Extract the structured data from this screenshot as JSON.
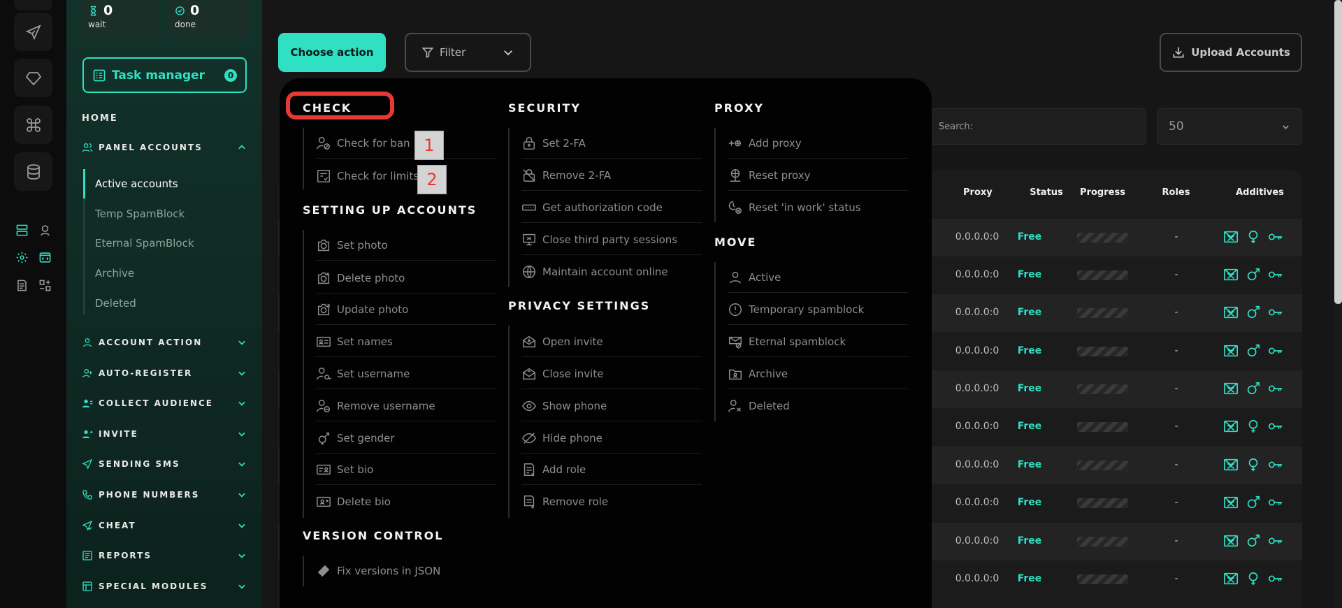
{
  "stats": {
    "wait_value": "0",
    "wait_label": "wait",
    "done_value": "0",
    "done_label": "done"
  },
  "task_manager": {
    "label": "Task manager",
    "badge": "0"
  },
  "nav": {
    "home": "HOME",
    "panel_accounts": "PANEL ACCOUNTS",
    "sub_items": [
      "Active accounts",
      "Temp SpamBlock",
      "Eternal SpamBlock",
      "Archive",
      "Deleted"
    ],
    "sections": [
      "ACCOUNT ACTION",
      "AUTO-REGISTER",
      "COLLECT AUDIENCE",
      "INVITE",
      "SENDING SMS",
      "PHONE NUMBERS",
      "CHEAT",
      "REPORTS",
      "SPECIAL MODULES"
    ]
  },
  "toolbar": {
    "choose_action": "Choose action",
    "filter": "Filter",
    "upload": "Upload Accounts"
  },
  "search": {
    "placeholder": "Search:"
  },
  "per_page": {
    "value": "50"
  },
  "table": {
    "headers": {
      "proxy": "Proxy",
      "status": "Status",
      "progress": "Progress",
      "roles": "Roles",
      "additives": "Additives"
    },
    "rows": [
      {
        "proxy": "0.0.0.0:0",
        "status": "Free",
        "roles": "-",
        "gender": "female"
      },
      {
        "proxy": "0.0.0.0:0",
        "status": "Free",
        "roles": "-",
        "gender": "male"
      },
      {
        "proxy": "0.0.0.0:0",
        "status": "Free",
        "roles": "-",
        "gender": "male"
      },
      {
        "proxy": "0.0.0.0:0",
        "status": "Free",
        "roles": "-",
        "gender": "male"
      },
      {
        "proxy": "0.0.0.0:0",
        "status": "Free",
        "roles": "-",
        "gender": "male"
      },
      {
        "proxy": "0.0.0.0:0",
        "status": "Free",
        "roles": "-",
        "gender": "female"
      },
      {
        "proxy": "0.0.0.0:0",
        "status": "Free",
        "roles": "-",
        "gender": "female"
      },
      {
        "proxy": "0.0.0.0:0",
        "status": "Free",
        "roles": "-",
        "gender": "male"
      },
      {
        "proxy": "0.0.0.0:0",
        "status": "Free",
        "roles": "-",
        "gender": "male"
      },
      {
        "proxy": "0.0.0.0:0",
        "status": "Free",
        "roles": "-",
        "gender": "female"
      }
    ]
  },
  "menu": {
    "check": {
      "title": "CHECK",
      "items": [
        "Check for ban",
        "Check for limits"
      ]
    },
    "setup": {
      "title": "SETTING UP ACCOUNTS",
      "items": [
        "Set photo",
        "Delete photo",
        "Update photo",
        "Set names",
        "Set username",
        "Remove username",
        "Set gender",
        "Set bio",
        "Delete bio"
      ]
    },
    "version": {
      "title": "VERSION CONTROL",
      "items": [
        "Fix versions in JSON"
      ]
    },
    "security": {
      "title": "SECURITY",
      "items": [
        "Set 2-FA",
        "Remove 2-FA",
        "Get authorization code",
        "Close third party sessions",
        "Maintain account online"
      ]
    },
    "privacy": {
      "title": "PRIVACY SETTINGS",
      "items": [
        "Open invite",
        "Close invite",
        "Show phone",
        "Hide phone",
        "Add role",
        "Remove role"
      ]
    },
    "proxy": {
      "title": "PROXY",
      "items": [
        "Add proxy",
        "Reset proxy",
        "Reset 'in work' status"
      ]
    },
    "move": {
      "title": "MOVE",
      "items": [
        "Active",
        "Temporary spamblock",
        "Eternal spamblock",
        "Archive",
        "Deleted"
      ]
    }
  },
  "annotations": [
    "1",
    "2"
  ],
  "colors": {
    "accent": "#2fe0c3",
    "highlight": "#e53a34"
  }
}
